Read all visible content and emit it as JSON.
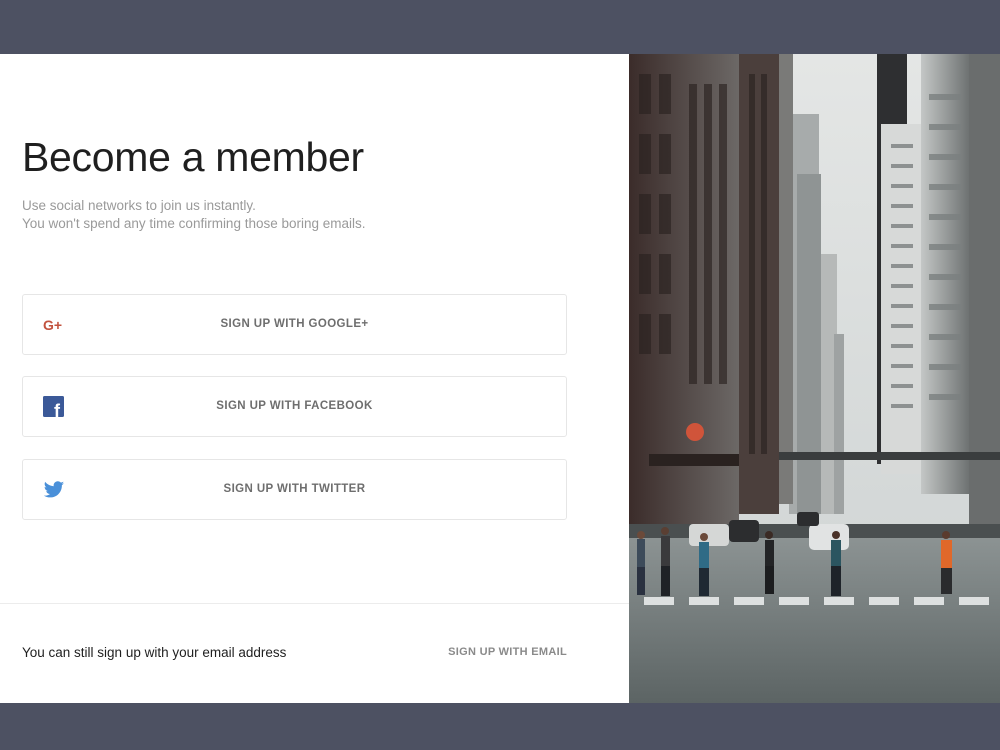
{
  "signup": {
    "title": "Become a member",
    "subtitle_line1": "Use social networks to join us instantly.",
    "subtitle_line2": "You won't spend any time confirming those boring emails.",
    "buttons": [
      {
        "label": "SIGN UP WITH GOOGLE+",
        "icon": "google-plus-icon",
        "icon_text": "G+",
        "color": "#c2523e"
      },
      {
        "label": "SIGN UP WITH FACEBOOK",
        "icon": "facebook-icon",
        "icon_text": "f",
        "color": "#3b5998"
      },
      {
        "label": "SIGN UP WITH TWITTER",
        "icon": "twitter-icon",
        "color": "#4a90d9"
      }
    ],
    "footer_text": "You can still sign up with your email address",
    "email_link": "SIGN UP WITH EMAIL"
  },
  "colors": {
    "page_background": "#4d5162",
    "card_background": "#ffffff",
    "title": "#1f1f1f",
    "muted_text": "#9a9a9a",
    "button_text": "#6e6e6e",
    "border": "#e6e6e6"
  },
  "hero_image": {
    "description_icon": "city-street-photo"
  }
}
